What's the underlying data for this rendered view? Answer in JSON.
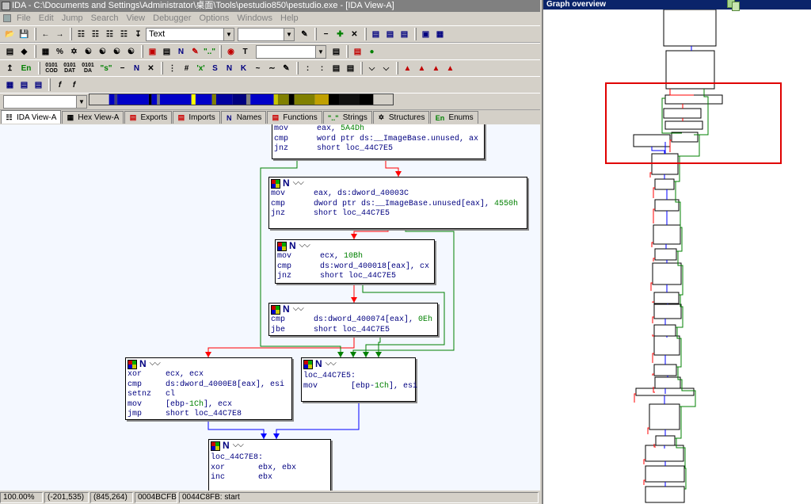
{
  "title_bar": {
    "text": "IDA - C:\\Documents and Settings\\Administrator\\桌面\\Tools\\pestudio850\\pestudio.exe - [IDA View-A]"
  },
  "menu": [
    "File",
    "Edit",
    "Jump",
    "Search",
    "View",
    "Debugger",
    "Options",
    "Windows",
    "Help"
  ],
  "toolbar": {
    "text_combo": "Text",
    "row3_labels": [
      "En",
      "0101 COD",
      "0101 DAT",
      "0101 DA",
      "\"s\"",
      "N",
      "K"
    ]
  },
  "tabs": [
    {
      "label": "IDA View-A",
      "icon": "ida-view-icon",
      "active": true
    },
    {
      "label": "Hex View-A",
      "icon": "hex-view-icon",
      "active": false
    },
    {
      "label": "Exports",
      "icon": "exports-icon",
      "active": false
    },
    {
      "label": "Imports",
      "icon": "imports-icon",
      "active": false
    },
    {
      "label": "Names",
      "icon": "names-icon",
      "active": false
    },
    {
      "label": "Functions",
      "icon": "functions-icon",
      "active": false
    },
    {
      "label": "Strings",
      "icon": "strings-icon",
      "active": false
    },
    {
      "label": "Structures",
      "icon": "structures-icon",
      "active": false
    },
    {
      "label": "Enums",
      "icon": "enums-icon",
      "active": false
    }
  ],
  "tab_icon_text": {
    "names": "N",
    "strings": "\"..\"",
    "enums": "En"
  },
  "nodes": [
    {
      "id": "n0",
      "header": false,
      "lines": [
        [
          "mov",
          "eax, ",
          "5A4Dh"
        ],
        [
          "cmp",
          "word ptr ds:__ImageBase.unused, ax",
          ""
        ],
        [
          "jnz",
          "short loc_44C7E5",
          ""
        ]
      ]
    },
    {
      "id": "n1",
      "header": true,
      "lines": [
        [
          "mov",
          "eax, ds:dword_40003C",
          ""
        ],
        [
          "cmp",
          "dword ptr ds:__ImageBase.unused[eax], ",
          "4550h"
        ],
        [
          "jnz",
          "short loc_44C7E5",
          ""
        ]
      ]
    },
    {
      "id": "n2",
      "header": true,
      "lines": [
        [
          "mov",
          "ecx, ",
          "10Bh"
        ],
        [
          "cmp",
          "ds:word_400018[eax], cx",
          ""
        ],
        [
          "jnz",
          "short loc_44C7E5",
          ""
        ]
      ]
    },
    {
      "id": "n3",
      "header": true,
      "lines": [
        [
          "cmp",
          "ds:dword_400074[eax], ",
          "0Eh"
        ],
        [
          "jbe",
          "short loc_44C7E5",
          ""
        ]
      ]
    },
    {
      "id": "n4",
      "header": true,
      "lines": [
        [
          "xor",
          "ecx, ecx",
          ""
        ],
        [
          "cmp",
          "ds:dword_4000E8[eax], esi",
          ""
        ],
        [
          "setnz",
          "cl",
          ""
        ],
        [
          "mov",
          "[ebp-",
          "1Ch",
          "], ecx"
        ],
        [
          "jmp",
          "short loc_44C7E8",
          ""
        ]
      ]
    },
    {
      "id": "n5",
      "header": true,
      "label": "loc_44C7E5:",
      "lines": [
        [
          "mov",
          "[ebp-",
          "1Ch",
          "], esi"
        ]
      ]
    },
    {
      "id": "n6",
      "header": true,
      "label": "loc_44C7E8:",
      "lines": [
        [
          "xor",
          "ebx, ebx",
          ""
        ],
        [
          "inc",
          "ebx",
          ""
        ]
      ]
    }
  ],
  "status": [
    "100.00%",
    "(-201,535)",
    "(845,264)",
    "0004BCFB",
    "0044C8FB: start"
  ],
  "overview": {
    "title": "Graph overview"
  },
  "colors": {
    "edge_true": "#008000",
    "edge_false": "#ff0000",
    "edge_uncond": "#0000ff",
    "viewport": "#e00000",
    "title_active": "#0a246a"
  }
}
